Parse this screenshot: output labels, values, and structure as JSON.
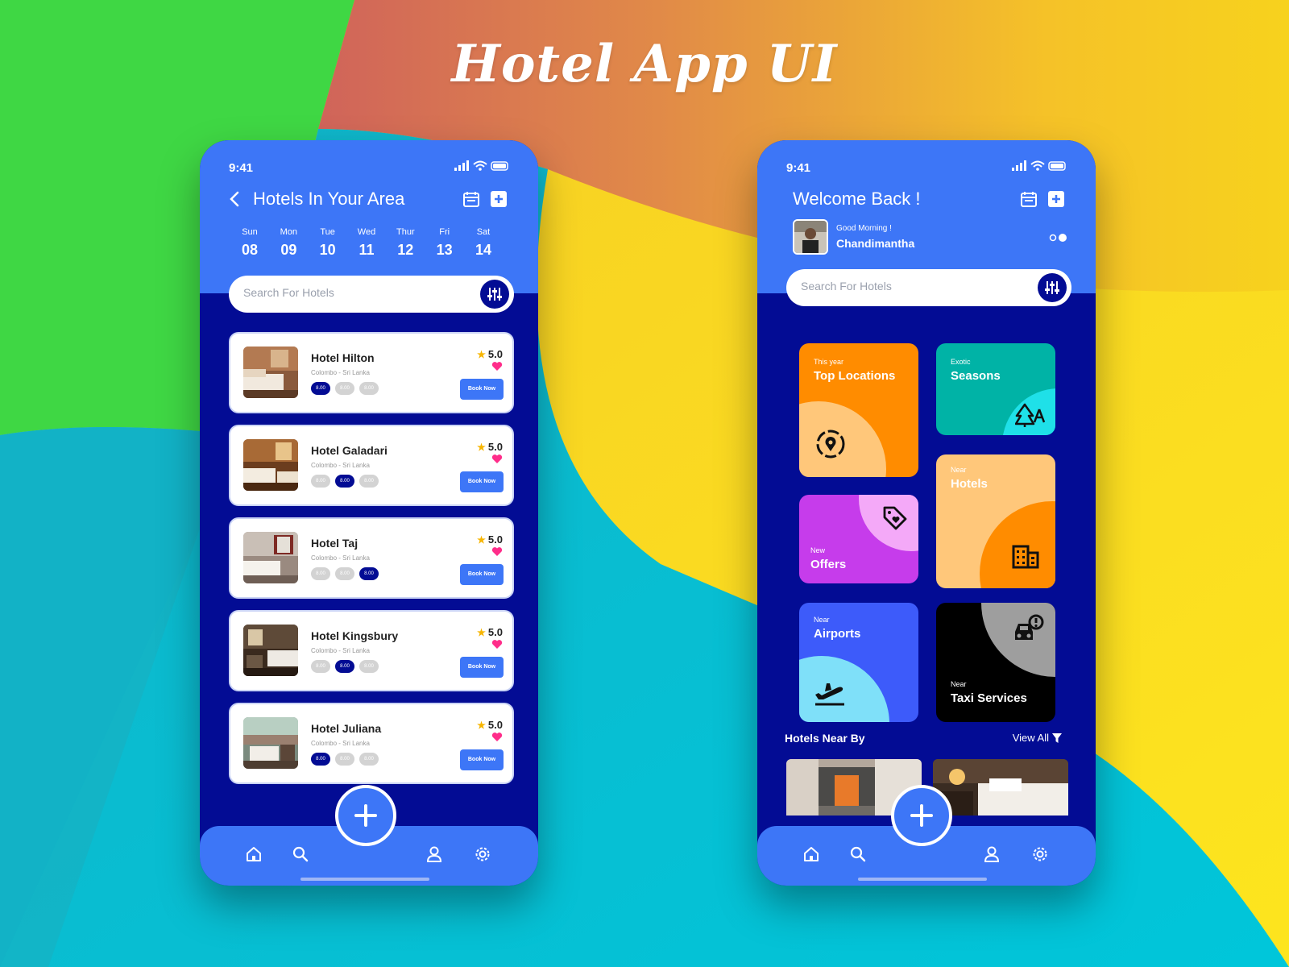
{
  "page": {
    "title": "Hotel App UI"
  },
  "colors": {
    "primary": "#3D76F7",
    "dark": "#030C94",
    "accent_orange": "#FF8C00",
    "accent_teal": "#00B3A6",
    "heart": "#FF2D8A",
    "star": "#F7B500"
  },
  "status_bar": {
    "time": "9:41"
  },
  "left_screen": {
    "header_title": "Hotels In Your Area",
    "days": [
      {
        "name": "Sun",
        "num": "08"
      },
      {
        "name": "Mon",
        "num": "09"
      },
      {
        "name": "Tue",
        "num": "10"
      },
      {
        "name": "Wed",
        "num": "11"
      },
      {
        "name": "Thur",
        "num": "12"
      },
      {
        "name": "Fri",
        "num": "13"
      },
      {
        "name": "Sat",
        "num": "14"
      }
    ],
    "search_placeholder": "Search For Hotels",
    "hotels": [
      {
        "name": "Hotel Hilton",
        "location": "Colombo - Sri Lanka",
        "rating": "5.0",
        "book_label": "Book Now",
        "pills": [
          "8.00",
          "8.00",
          "8.00"
        ],
        "active_pill": 0
      },
      {
        "name": "Hotel Galadari",
        "location": "Colombo - Sri Lanka",
        "rating": "5.0",
        "book_label": "Book Now",
        "pills": [
          "8.00",
          "8.00",
          "8.00"
        ],
        "active_pill": 1
      },
      {
        "name": "Hotel Taj",
        "location": "Colombo - Sri Lanka",
        "rating": "5.0",
        "book_label": "Book Now",
        "pills": [
          "8.00",
          "8.00",
          "8.00"
        ],
        "active_pill": 2
      },
      {
        "name": "Hotel Kingsbury",
        "location": "Colombo - Sri Lanka",
        "rating": "5.0",
        "book_label": "Book Now",
        "pills": [
          "8.00",
          "8.00",
          "8.00"
        ],
        "active_pill": 1
      },
      {
        "name": "Hotel Juliana",
        "location": "Colombo - Sri Lanka",
        "rating": "5.0",
        "book_label": "Book Now",
        "pills": [
          "8.00",
          "8.00",
          "8.00"
        ],
        "active_pill": 0
      }
    ]
  },
  "right_screen": {
    "header_title": "Welcome Back !",
    "greeting": "Good Morning !",
    "user_name": "Chandimantha",
    "search_placeholder": "Search For Hotels",
    "tiles": {
      "top_locations": {
        "small": "This year",
        "big": "Top Locations",
        "icon": "location-pin-icon"
      },
      "seasons": {
        "small": "Exotic",
        "big": "Seasons",
        "icon": "trees-icon"
      },
      "offers": {
        "small": "New",
        "big": "Offers",
        "icon": "tag-heart-icon"
      },
      "hotels": {
        "small": "Near",
        "big": "Hotels",
        "icon": "building-icon"
      },
      "airports": {
        "small": "Near",
        "big": "Airports",
        "icon": "plane-takeoff-icon"
      },
      "taxi": {
        "small": "Near",
        "big": "Taxi Services",
        "icon": "taxi-alert-icon"
      }
    },
    "nearby_title": "Hotels Near By",
    "view_all": "View All"
  },
  "nav": {
    "items": [
      "home-icon",
      "search-icon",
      "add-icon",
      "user-icon",
      "settings-icon"
    ]
  }
}
